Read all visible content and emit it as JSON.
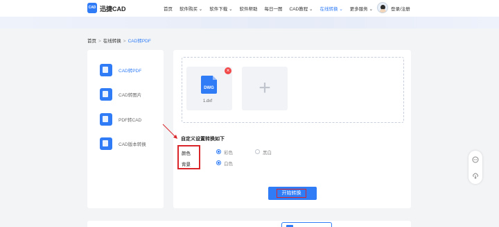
{
  "header": {
    "logo_text": "CAD",
    "brand": "迅捷CAD",
    "nav": [
      {
        "label": "首页",
        "active": false
      },
      {
        "label": "软件购买 ⌄",
        "active": false
      },
      {
        "label": "软件下载 ⌄",
        "active": false
      },
      {
        "label": "软件帮助",
        "active": false
      },
      {
        "label": "每日一图",
        "active": false
      },
      {
        "label": "CAD教程 ⌄",
        "active": false
      },
      {
        "label": "在线转换 ⌄",
        "active": true
      },
      {
        "label": "更多服务 ⌄",
        "active": false
      }
    ],
    "login": "登录/注册"
  },
  "breadcrumb": {
    "home": "首页",
    "section": "在线转换",
    "current": "CAD转PDF",
    "separator": ">"
  },
  "sidebar": {
    "items": [
      {
        "label": "CAD转PDF",
        "icon": "cad-pdf-icon",
        "active": true
      },
      {
        "label": "CAD转图片",
        "icon": "cad-image-icon",
        "active": false
      },
      {
        "label": "PDF转CAD",
        "icon": "pdf-cad-icon",
        "active": false
      },
      {
        "label": "CAD版本转换",
        "icon": "cad-version-icon",
        "active": false
      }
    ]
  },
  "upload": {
    "file_badge": "DWG",
    "file_name": "1.dxf",
    "remove_symbol": "×",
    "add_symbol": "+"
  },
  "options": {
    "title": "自定义设置转换如下",
    "color_label": "颜色",
    "color_options": [
      {
        "label": "彩色",
        "selected": true
      },
      {
        "label": "黑白",
        "selected": false
      }
    ],
    "bg_label": "背景",
    "bg_options": [
      {
        "label": "白色",
        "selected": true
      }
    ]
  },
  "start_button": "开始转换",
  "float_icons": [
    "chat-icon",
    "download-cloud-icon"
  ],
  "colors": {
    "accent": "#2f7cf6",
    "highlight": "#d9252a",
    "error": "#f24a4a"
  }
}
